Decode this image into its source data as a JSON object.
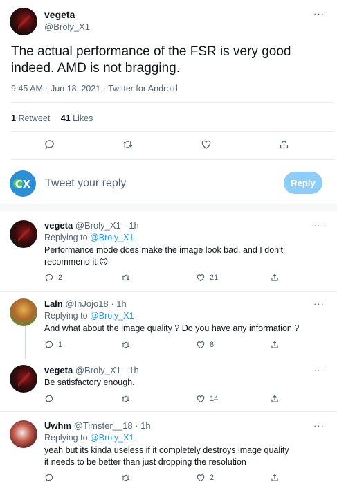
{
  "main": {
    "name": "vegeta",
    "handle": "@Broly_X1",
    "text": "The actual performance of the FSR is very good indeed. AMD is not bragging.",
    "meta": "9:45 AM · Jun 18, 2021 · Twitter for Android",
    "retweets_count": "1",
    "retweets_label": "Retweet",
    "likes_count": "41",
    "likes_label": "Likes",
    "more": "···"
  },
  "compose": {
    "placeholder": "Tweet your reply",
    "reply_button": "Reply",
    "avatar_text": "CX"
  },
  "replies": [
    {
      "name": "vegeta",
      "handle": "@Broly_X1 · 1h",
      "replying_prefix": "Replying to",
      "replying_to": "@Broly_X1",
      "text": "Performance mode does make the image look bad, and I don't recommend it.🙃",
      "reply_count": "2",
      "retweet_count": "",
      "like_count": "21"
    },
    {
      "name": "Laln",
      "handle": "@InJojo18 · 1h",
      "replying_prefix": "Replying to",
      "replying_to": "@Broly_X1",
      "text": "And what about the image quality ? Do you have any information ?",
      "reply_count": "1",
      "retweet_count": "",
      "like_count": "8"
    },
    {
      "name": "vegeta",
      "handle": "@Broly_X1 · 1h",
      "text": "Be satisfactory enough.",
      "reply_count": "",
      "retweet_count": "",
      "like_count": "14"
    },
    {
      "name": "Uwhm",
      "handle": "@Timster__18 · 1h",
      "replying_prefix": "Replying to",
      "replying_to": "@Broly_X1",
      "text_line1": "yeah but its kinda useless if it completely destroys image quality",
      "text_line2": "it needs to be better than just dropping the resolution",
      "reply_count": "",
      "retweet_count": "",
      "like_count": "2"
    }
  ],
  "icons": {
    "reply": "reply-icon",
    "retweet": "retweet-icon",
    "like": "heart-icon",
    "share": "share-icon",
    "more": "more-icon"
  },
  "colors": {
    "accent": "#1d9bf0",
    "reply_button_disabled": "#8ecdf8",
    "muted_text": "#536471"
  }
}
